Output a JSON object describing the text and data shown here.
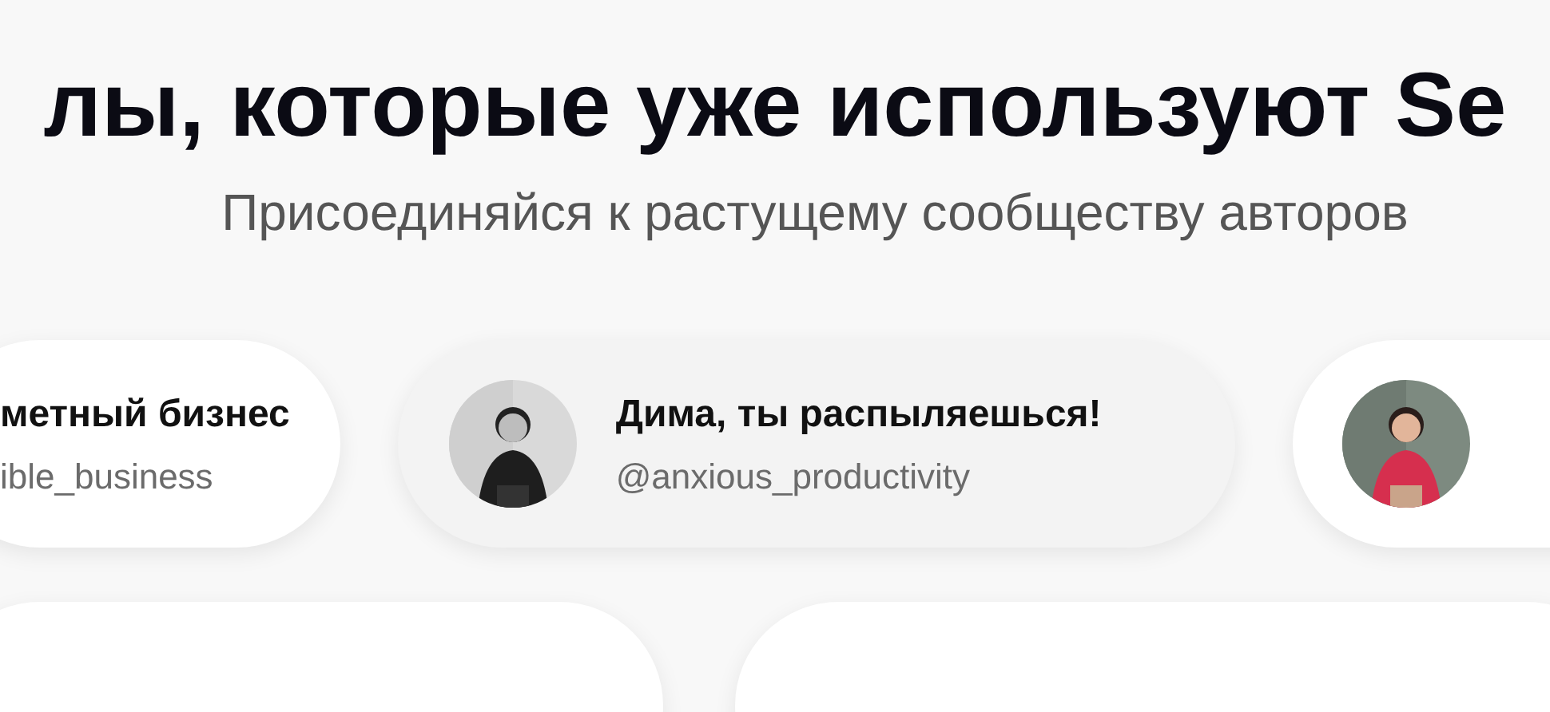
{
  "heading": "лы, которые уже используют Se",
  "subheading": "Присоединяйся к растущему сообществу авторов",
  "channels": [
    {
      "name": "метный бизнес",
      "handle": "ible_business",
      "avatar": false,
      "selected": false
    },
    {
      "name": "Дима, ты распыляешься!",
      "handle": "@anxious_productivity",
      "avatar": true,
      "selected": true
    },
    {
      "avatar": true,
      "selected": false
    }
  ]
}
